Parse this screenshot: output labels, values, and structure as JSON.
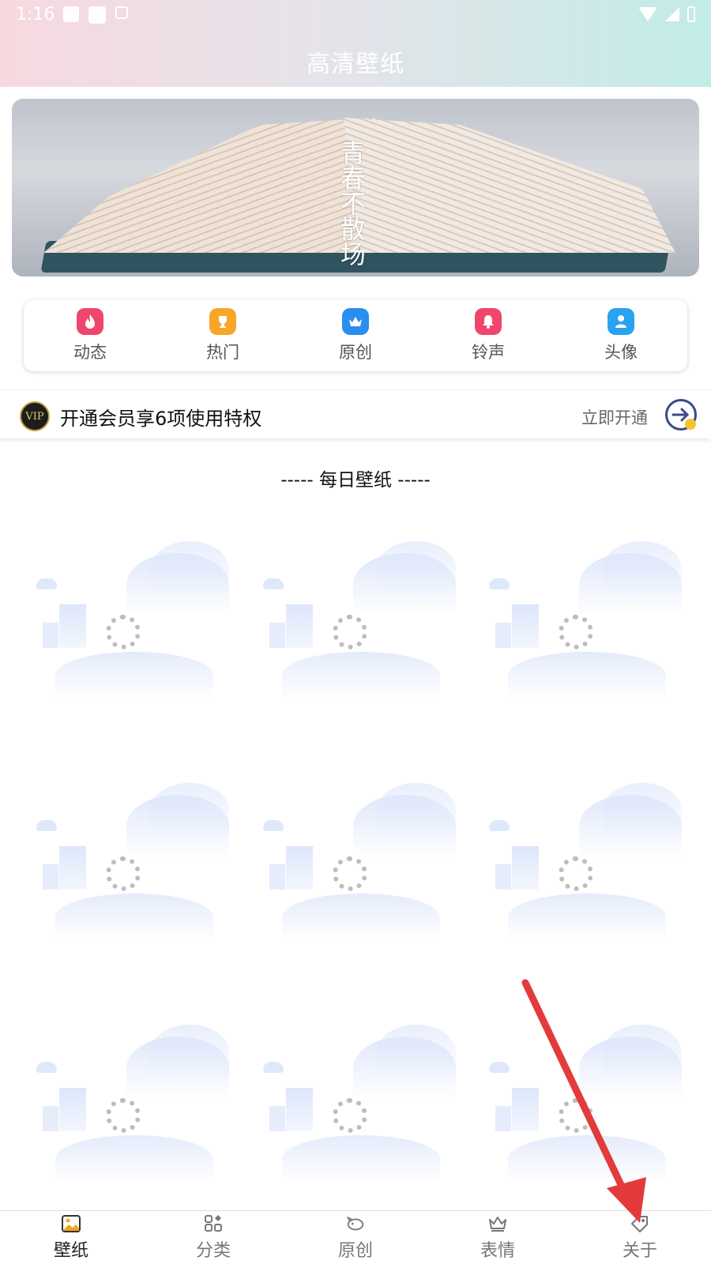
{
  "status_bar": {
    "time": "1:16",
    "icons": [
      "image-icon",
      "square-icon",
      "a-icon",
      "wifi-icon",
      "signal-icon",
      "battery-icon"
    ]
  },
  "header": {
    "title": "高清壁纸"
  },
  "banner": {
    "text": "青春不散场",
    "dots": 4,
    "active_dot": 1
  },
  "quick_menu": [
    {
      "label": "动态",
      "icon": "flame-icon",
      "color": "#f0466e"
    },
    {
      "label": "热门",
      "icon": "trophy-icon",
      "color": "#f7a62a"
    },
    {
      "label": "原创",
      "icon": "crown-icon",
      "color": "#2a8ef0"
    },
    {
      "label": "铃声",
      "icon": "bell-icon",
      "color": "#f0466e"
    },
    {
      "label": "头像",
      "icon": "person-icon",
      "color": "#29a3f0"
    }
  ],
  "vip": {
    "badge": "VIP",
    "text": "开通会员享6项使用特权",
    "action": "立即开通"
  },
  "section": {
    "title": "-----  每日壁纸  -----"
  },
  "wallpaper_grid": {
    "count": 9,
    "state": "loading"
  },
  "bottom_nav": [
    {
      "label": "壁纸",
      "icon": "image-icon",
      "active": true
    },
    {
      "label": "分类",
      "icon": "category-icon",
      "active": false
    },
    {
      "label": "原创",
      "icon": "piggy-icon",
      "active": false
    },
    {
      "label": "表情",
      "icon": "crown-icon",
      "active": false
    },
    {
      "label": "关于",
      "icon": "tag-icon",
      "active": false
    }
  ],
  "annotation": {
    "color": "#e33b3b"
  }
}
